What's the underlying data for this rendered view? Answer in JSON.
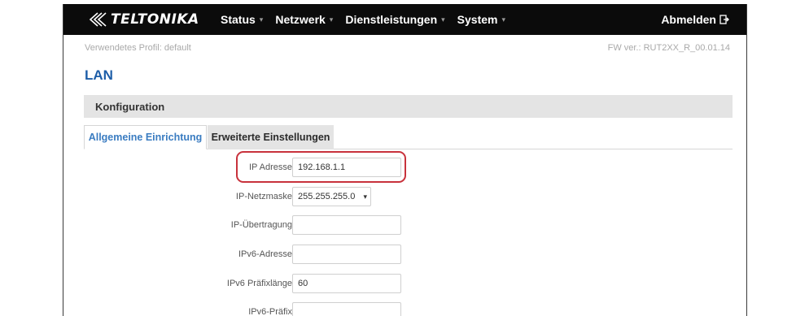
{
  "brand": {
    "name": "TELTONIKA"
  },
  "nav": {
    "items": [
      {
        "label": "Status"
      },
      {
        "label": "Netzwerk"
      },
      {
        "label": "Dienstleistungen"
      },
      {
        "label": "System"
      }
    ],
    "logout_label": "Abmelden"
  },
  "profile": "Verwendetes Profil: default",
  "fw_version": "FW ver.: RUT2XX_R_00.01.14",
  "page_title": "LAN",
  "section_title": "Konfiguration",
  "tabs": [
    {
      "label": "Allgemeine Einrichtung",
      "active": true
    },
    {
      "label": "Erweiterte Einstellungen",
      "active": false
    }
  ],
  "form": {
    "ip_address": {
      "label": "IP Adresse",
      "value": "192.168.1.1"
    },
    "netmask": {
      "label": "IP-Netzmaske",
      "value": "255.255.255.0"
    },
    "broadcast": {
      "label": "IP-Übertragung",
      "value": ""
    },
    "ipv6_address": {
      "label": "IPv6-Adresse",
      "value": ""
    },
    "ipv6_prefix_length": {
      "label": "IPv6 Präfixlänge",
      "value": "60"
    },
    "ipv6_prefix": {
      "label": "IPv6-Präfix",
      "value": ""
    }
  },
  "colors": {
    "accent": "#1e5ea8",
    "tab_active_text": "#3a7cc1",
    "highlight": "#c8323c",
    "navbar": "#0b0b0b"
  }
}
